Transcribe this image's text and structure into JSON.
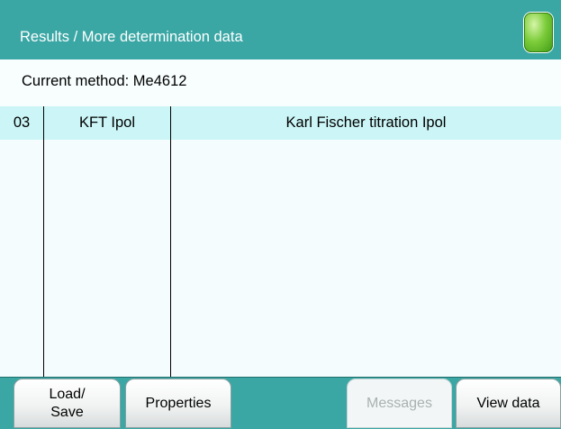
{
  "header": {
    "title": "Results / More determination data",
    "status_indicator": "green-led",
    "accent_color": "#3aa7a5"
  },
  "method": {
    "label": "Current method: Me4612"
  },
  "table": {
    "rows": [
      {
        "number": "03",
        "short_name": "KFT Ipol",
        "full_name": "Karl Fischer titration Ipol"
      }
    ]
  },
  "buttons": {
    "load_save_line1": "Load/",
    "load_save_line2": "Save",
    "properties": "Properties",
    "messages": "Messages",
    "view_data": "View data"
  }
}
